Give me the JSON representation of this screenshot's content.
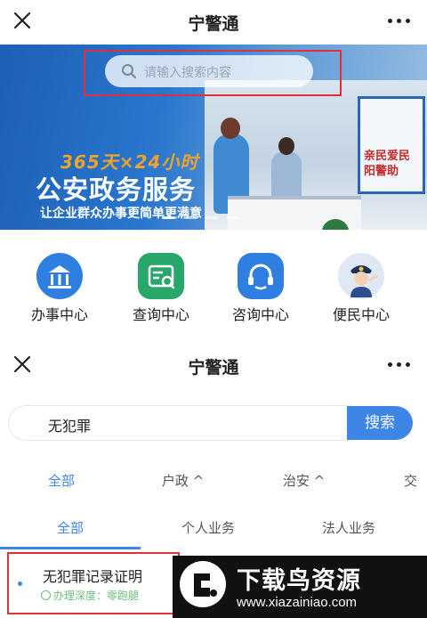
{
  "screen1": {
    "title": "宁警通",
    "search_placeholder": "请输入搜索内容",
    "banner": {
      "slogan_numbers": "365天×24小时",
      "slogan_main": "公安政务服务",
      "slogan_sub": "让企业群众办事更简单更满意",
      "poster_text": "亲民爱民 阳警助"
    },
    "services": [
      {
        "label": "办事中心",
        "icon": "government-building-icon",
        "color": "#2f7fe0"
      },
      {
        "label": "查询中心",
        "icon": "document-search-icon",
        "color": "#27a86a"
      },
      {
        "label": "咨询中心",
        "icon": "headset-chat-icon",
        "color": "#2f7fe0"
      },
      {
        "label": "便民中心",
        "icon": "police-officer-icon",
        "color": "#2a4e8f"
      }
    ]
  },
  "screen2": {
    "title": "宁警通",
    "search_value": "无犯罪",
    "search_button": "搜索",
    "filters": [
      "全部",
      "户政 ^",
      "治安 ^",
      "交"
    ],
    "tabs": [
      "全部",
      "个人业务",
      "法人业务"
    ],
    "result": {
      "name": "无犯罪记录证明",
      "meta": "办理深度：零跑腿"
    }
  },
  "watermark": {
    "title": "下载鸟资源",
    "url": "www.xiazainiao.com"
  },
  "colors": {
    "accent": "#3e86e6",
    "highlight_box": "#e0303a",
    "meta_green": "#6cc07a"
  }
}
